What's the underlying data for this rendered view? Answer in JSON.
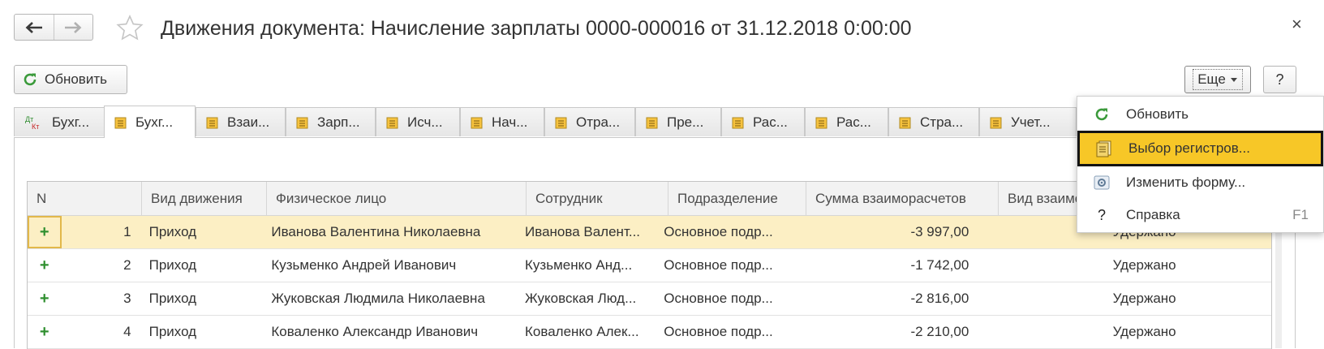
{
  "window": {
    "title": "Движения документа: Начисление зарплаты 0000-000016 от 31.12.2018 0:00:00",
    "close_label": "×"
  },
  "toolbar": {
    "refresh_label": "Обновить",
    "more_label": "Еще",
    "help_label": "?"
  },
  "tabs": [
    {
      "label": "Бухг...",
      "icon": "dt-kt-icon",
      "active": false
    },
    {
      "label": "Бухг...",
      "icon": "register-icon",
      "active": true
    },
    {
      "label": "Взаи...",
      "icon": "register-icon",
      "active": false
    },
    {
      "label": "Зарп...",
      "icon": "register-icon",
      "active": false
    },
    {
      "label": "Исч...",
      "icon": "register-icon",
      "active": false
    },
    {
      "label": "Нач...",
      "icon": "register-icon",
      "active": false
    },
    {
      "label": "Отра...",
      "icon": "register-icon",
      "active": false
    },
    {
      "label": "Пре...",
      "icon": "register-icon",
      "active": false
    },
    {
      "label": "Рас...",
      "icon": "register-icon",
      "active": false
    },
    {
      "label": "Рас...",
      "icon": "register-icon",
      "active": false
    },
    {
      "label": "Стра...",
      "icon": "register-icon",
      "active": false
    },
    {
      "label": "Учет...",
      "icon": "register-icon",
      "active": false
    }
  ],
  "dt_kt": {
    "dt": "Дт",
    "kt": "Кт"
  },
  "table": {
    "columns": [
      "N",
      "Вид движения",
      "Физическое лицо",
      "Сотрудник",
      "Подразделение",
      "Сумма взаиморасчетов",
      "Вид взаимора"
    ],
    "rows": [
      {
        "n": "1",
        "vid": "Приход",
        "fiz": "Иванова Валентина Николаевна",
        "sotr": "Иванова Валент...",
        "podr": "Основное подр...",
        "sum": "-3 997,00",
        "ud": "Удержано"
      },
      {
        "n": "2",
        "vid": "Приход",
        "fiz": "Кузьменко Андрей Иванович",
        "sotr": "Кузьменко Анд...",
        "podr": "Основное подр...",
        "sum": "-1 742,00",
        "ud": "Удержано"
      },
      {
        "n": "3",
        "vid": "Приход",
        "fiz": "Жуковская Людмила Николаевна",
        "sotr": "Жуковская Люд...",
        "podr": "Основное подр...",
        "sum": "-2 816,00",
        "ud": "Удержано"
      },
      {
        "n": "4",
        "vid": "Приход",
        "fiz": "Коваленко Александр Иванович",
        "sotr": "Коваленко Алек...",
        "podr": "Основное подр...",
        "sum": "-2 210,00",
        "ud": "Удержано"
      }
    ],
    "plus_glyph": "+"
  },
  "menu": {
    "items": [
      {
        "label": "Обновить",
        "icon": "refresh-icon",
        "shortcut": ""
      },
      {
        "label": "Выбор регистров...",
        "icon": "registers-icon",
        "shortcut": "",
        "highlighted": true
      },
      {
        "label": "Изменить форму...",
        "icon": "settings-form-icon",
        "shortcut": ""
      },
      {
        "label": "Справка",
        "icon": "help-icon",
        "shortcut": "F1"
      }
    ]
  },
  "colors": {
    "accent_highlight": "#f7c727",
    "selected_row": "#fcefc4",
    "refresh_green": "#3b9a3b"
  }
}
